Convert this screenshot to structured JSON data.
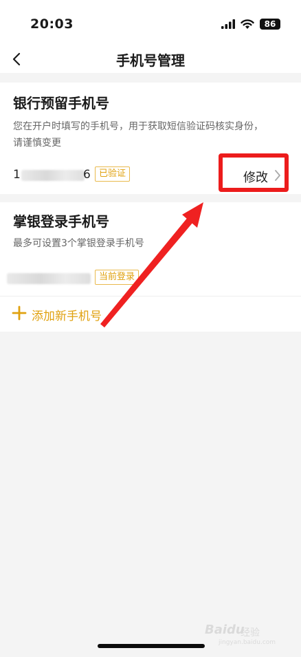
{
  "status_bar": {
    "time": "20:03",
    "battery": "86"
  },
  "nav": {
    "title": "手机号管理"
  },
  "bank_phone": {
    "title": "银行预留手机号",
    "desc_line1": "您在开户时填写的手机号，用于获取短信验证码核实身份，",
    "desc_line2": "请谨慎变更",
    "phone_first": "1",
    "phone_last": "6",
    "tag": "已验证",
    "modify_label": "修改"
  },
  "login_phone": {
    "title": "掌银登录手机号",
    "desc": "最多可设置3个掌银登录手机号",
    "tag": "当前登录",
    "add_label": "添加新手机号"
  },
  "watermark": {
    "brand": "Baidu",
    "sub": "经验",
    "url": "jingyan.baidu.com"
  },
  "colors": {
    "accent": "#e0a10f",
    "highlight": "#ec1c1c",
    "background": "#f4f4f4"
  },
  "icons": {
    "back": "chevron-left-icon",
    "chevron": "chevron-right-icon",
    "plus": "plus-icon",
    "wifi": "wifi-icon",
    "signal": "signal-icon",
    "battery": "battery-icon"
  }
}
